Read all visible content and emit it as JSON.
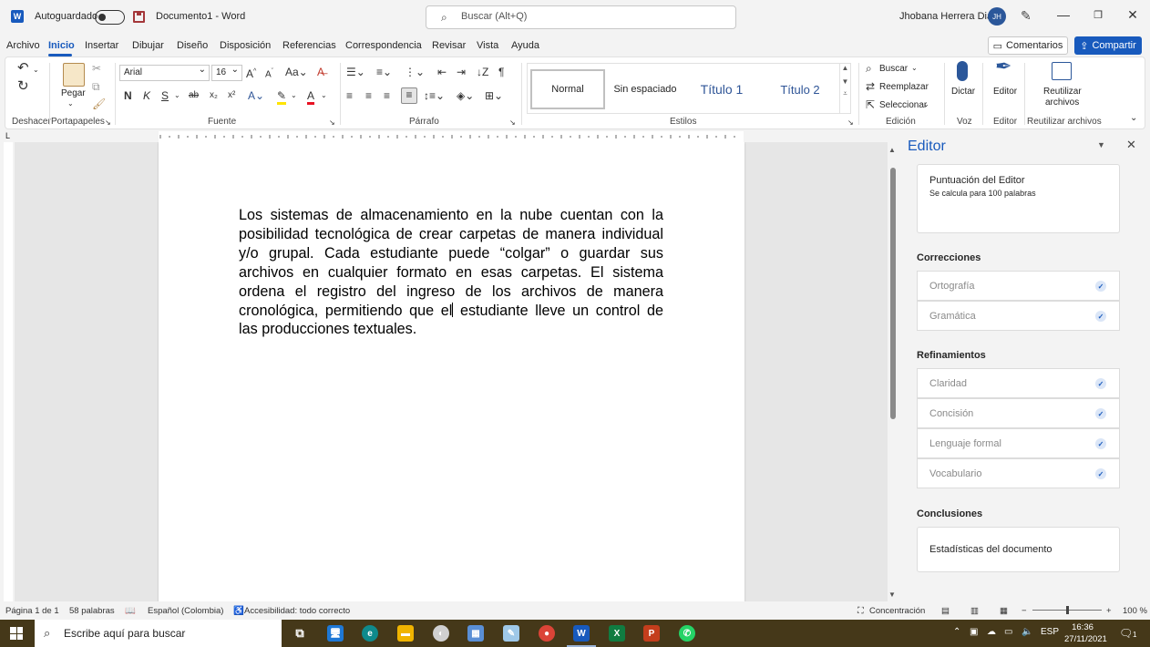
{
  "titlebar": {
    "autosave_label": "Autoguardado",
    "doc_title": "Documento1 - Word",
    "search_placeholder": "Buscar (Alt+Q)",
    "user_name": "Jhobana Herrera Diaz",
    "avatar_initials": "JH",
    "minimize": "—",
    "restore": "❐",
    "close": "✕"
  },
  "menu": {
    "tabs": [
      "Archivo",
      "Inicio",
      "Insertar",
      "Dibujar",
      "Diseño",
      "Disposición",
      "Referencias",
      "Correspondencia",
      "Revisar",
      "Vista",
      "Ayuda"
    ],
    "comments_label": "Comentarios",
    "share_label": "Compartir"
  },
  "ribbon": {
    "undo_group": "Deshacer",
    "clipboard_group": "Portapapeles",
    "paste_label": "Pegar",
    "font_group": "Fuente",
    "font_name": "Arial",
    "font_size": "16",
    "paragraph_group": "Párrafo",
    "styles_group": "Estilos",
    "styles": [
      "Normal",
      "Sin espaciado",
      "Título 1",
      "Título 2"
    ],
    "editing_group": "Edición",
    "find_label": "Buscar",
    "replace_label": "Reemplazar",
    "select_label": "Seleccionar",
    "voice_group": "Voz",
    "dictate_label": "Dictar",
    "editor_group": "Editor",
    "editor_label": "Editor",
    "reuse_group": "Reutilizar archivos",
    "reuse_label_1": "Reutilizar",
    "reuse_label_2": "archivos",
    "bold": "N",
    "italic": "K",
    "underline": "S"
  },
  "document": {
    "text_before_caret": "Los sistemas de almacenamiento en la nube cuentan con la posibilidad tecnológica de crear carpetas de manera individual y/o grupal. Cada estudiante puede “colgar” o guardar sus archivos en cualquier formato en esas carpetas. El sistema ordena el registro del ingreso de los archivos de manera cronológica, permitiendo que el",
    "text_after_caret": " estudiante lleve un control de las producciones textuales."
  },
  "editor_pane": {
    "title": "Editor",
    "score_title": "Puntuación del Editor",
    "score_sub": "Se calcula para 100 palabras",
    "corrections_head": "Correcciones",
    "corrections": [
      "Ortografía",
      "Gramática"
    ],
    "refinements_head": "Refinamientos",
    "refinements": [
      "Claridad",
      "Concisión",
      "Lenguaje formal",
      "Vocabulario"
    ],
    "conclusions_head": "Conclusiones",
    "stats_label": "Estadísticas del documento"
  },
  "statusbar": {
    "page": "Página 1 de 1",
    "words": "58 palabras",
    "language": "Español (Colombia)",
    "accessibility": "Accesibilidad: todo correcto",
    "focus": "Concentración",
    "zoom": "100 %"
  },
  "taskbar": {
    "search_placeholder": "Escribe aquí para buscar",
    "lang": "ESP",
    "time": "16:36",
    "date": "27/11/2021",
    "notifications": "1"
  },
  "colors": {
    "accent": "#185abd",
    "taskbar": "#453819",
    "excel": "#107c41",
    "powerpoint": "#c43e1c",
    "whatsapp": "#25d366"
  }
}
